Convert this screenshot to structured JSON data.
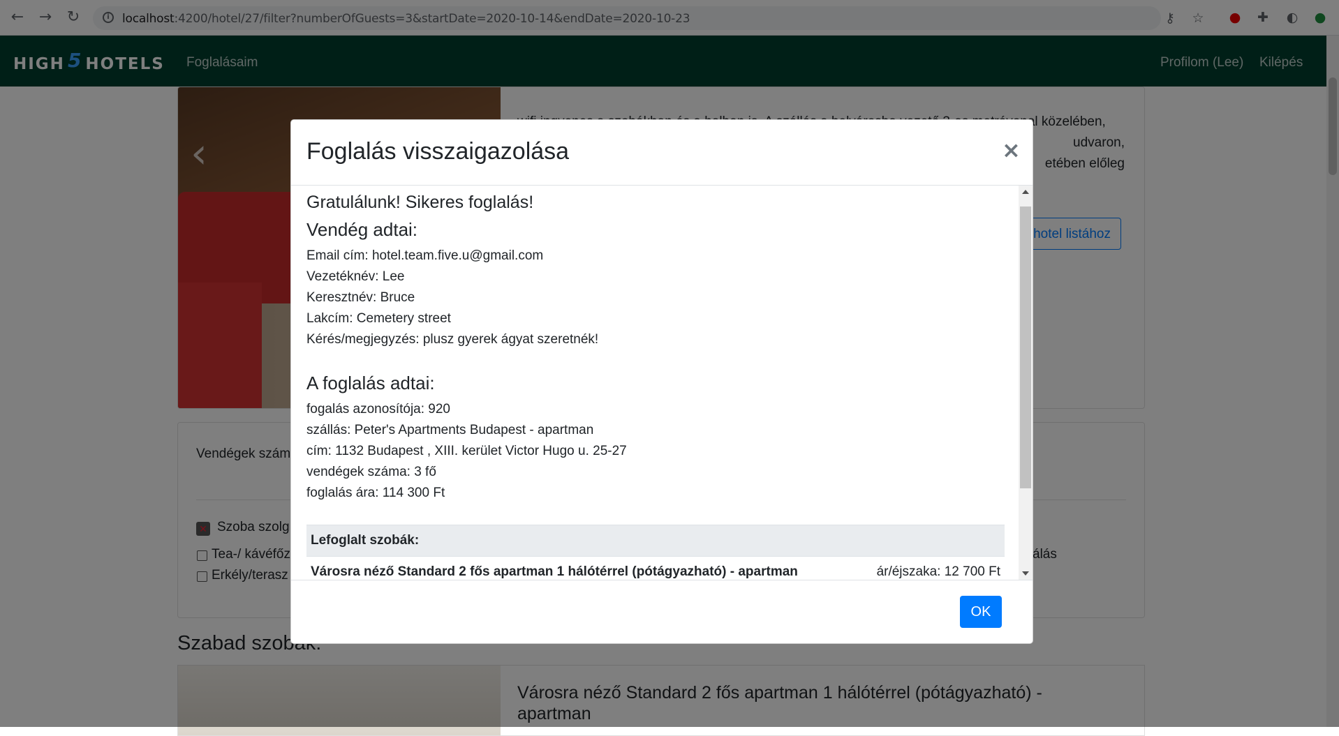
{
  "browser": {
    "url_host": "localhost",
    "url_rest": ":4200/hotel/27/filter?numberOfGuests=3&startDate=2020-10-14&endDate=2020-10-23"
  },
  "nav": {
    "logo_left": "HIGH",
    "logo_five": "5",
    "logo_right": "HOTELS",
    "my_bookings": "Foglalásaim",
    "profile": "Profilom (Lee)",
    "logout": "Kilépés"
  },
  "hotel": {
    "desc_line1": "wifi ingyenes a szobákban és a halban is. A szállás a belvárosba vezető 3-as metróvonal közelében,",
    "desc_line2": "udvaron,",
    "desc_line3": "etében előleg",
    "back_button": "hotel listához"
  },
  "filters": {
    "guests_label": "Vendégek szám",
    "room_service": "Szoba szolg",
    "coffee": "Tea-/ kávéfőz",
    "balcony": "Erkély/terasz",
    "right_item": "álás"
  },
  "rooms_section": {
    "title": "Szabad szobák:",
    "first_room_title": "Városra néző Standard 2 fős apartman 1 hálótérrel (pótágyazható) - apartman"
  },
  "modal": {
    "title": "Foglalás visszaigazolása",
    "close": "×",
    "congrats": "Gratulálunk! Sikeres foglalás!",
    "guest_heading": "Vendég adtai:",
    "email": "Email cím: hotel.team.five.u@gmail.com",
    "lastname": "Vezetéknév: Lee",
    "firstname": "Keresztnév: Bruce",
    "address": "Lakcím: Cemetery street",
    "note": "Kérés/megjegyzés: plusz gyerek ágyat szeretnék!",
    "booking_heading": "A foglalás adtai:",
    "booking_id": "fogalás azonosítója: 920",
    "accommodation": "szállás: Peter's Apartments Budapest - apartman",
    "booking_address": "cím: 1132 Budapest , XIII. kerület Victor Hugo u. 25-27",
    "guests": "vendégek száma: 3 fő",
    "price": "foglalás ára: 114 300 Ft",
    "rooms_header": "Lefoglalt szobák:",
    "rooms": [
      {
        "name": "Városra néző Standard 2 fős apartman 1 hálótérrel (pótágyazható) - apartman",
        "price": "ár/éjszaka: 12 700 Ft"
      }
    ],
    "ok": "OK"
  }
}
